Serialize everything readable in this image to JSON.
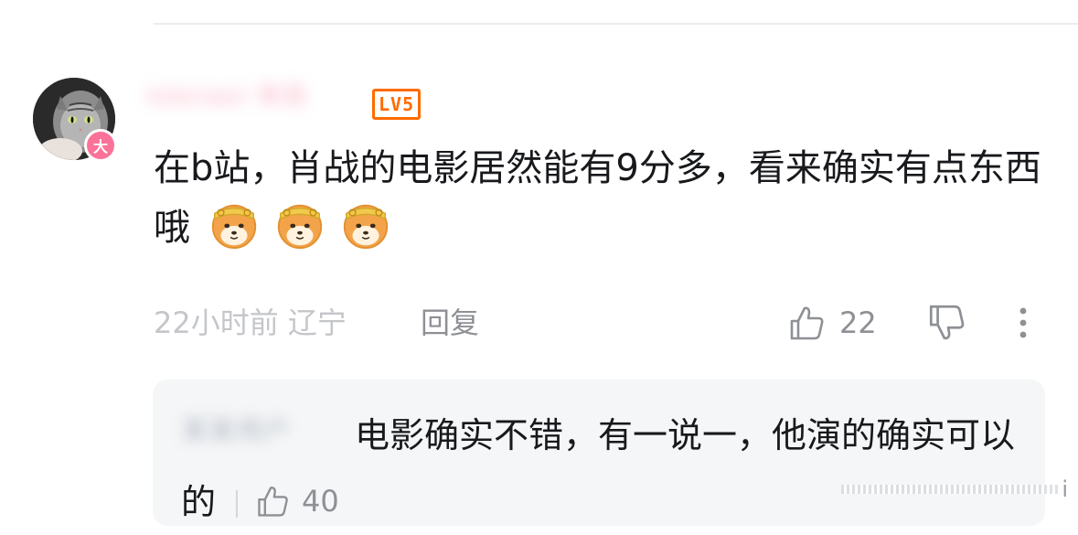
{
  "comment": {
    "username": "Islenaer 单身",
    "avatar_badge": "大",
    "level": "LV5",
    "text": "在b站，肖战的电影居然能有9分多，看来确实有点东西哦",
    "emojis": [
      "doge-emoji",
      "doge-emoji",
      "doge-emoji"
    ],
    "time": "22小时前",
    "location": "辽宁",
    "time_location": "22小时前 辽宁",
    "reply_label": "回复",
    "like_count": "22"
  },
  "reply": {
    "username": "某某用户",
    "text": "电影确实不错，有一说一，他演的确实可以的",
    "like_count": "40"
  },
  "colors": {
    "accent_pink": "#fb7299",
    "level_orange": "#ff6b00",
    "text_primary": "#18191c",
    "text_secondary": "#8e9095",
    "text_muted": "#c4c6ca",
    "reply_bg": "#f5f6f7"
  }
}
